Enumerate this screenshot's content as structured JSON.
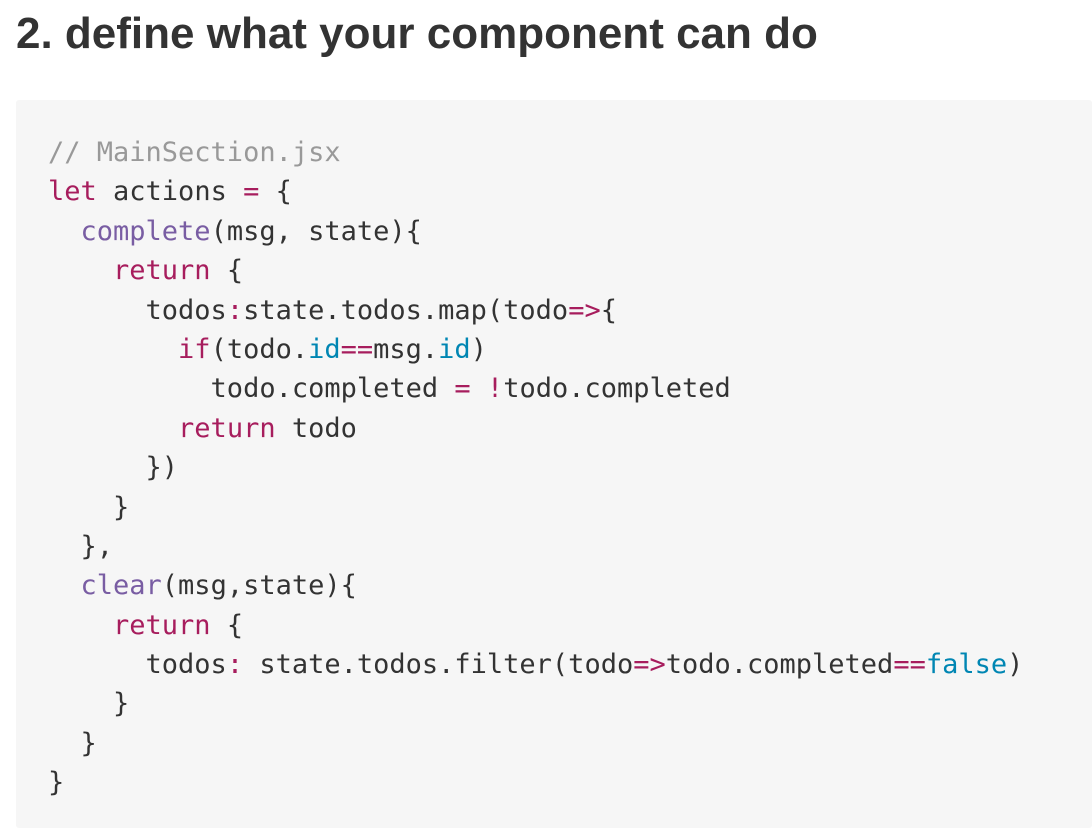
{
  "document": {
    "heading": "2. define what your component can do"
  },
  "code_block": {
    "lines": [
      [
        {
          "t": "// MainSection.jsx",
          "k": "comment"
        }
      ],
      [
        {
          "t": "let",
          "k": "keyword"
        },
        {
          "t": " actions ",
          "k": "plain"
        },
        {
          "t": "=",
          "k": "op"
        },
        {
          "t": " {",
          "k": "plain"
        }
      ],
      [
        {
          "t": "  ",
          "k": "plain"
        },
        {
          "t": "complete",
          "k": "func"
        },
        {
          "t": "(msg, state){",
          "k": "plain"
        }
      ],
      [
        {
          "t": "    ",
          "k": "plain"
        },
        {
          "t": "return",
          "k": "keyword"
        },
        {
          "t": " {",
          "k": "plain"
        }
      ],
      [
        {
          "t": "      todos",
          "k": "plain"
        },
        {
          "t": ":",
          "k": "op"
        },
        {
          "t": "state.todos.map(todo",
          "k": "plain"
        },
        {
          "t": "=>",
          "k": "op"
        },
        {
          "t": "{",
          "k": "plain"
        }
      ],
      [
        {
          "t": "        ",
          "k": "plain"
        },
        {
          "t": "if",
          "k": "keyword"
        },
        {
          "t": "(todo.",
          "k": "plain"
        },
        {
          "t": "id",
          "k": "prop"
        },
        {
          "t": "==",
          "k": "op"
        },
        {
          "t": "msg.",
          "k": "plain"
        },
        {
          "t": "id",
          "k": "prop"
        },
        {
          "t": ")",
          "k": "plain"
        }
      ],
      [
        {
          "t": "          todo.completed ",
          "k": "plain"
        },
        {
          "t": "=",
          "k": "op"
        },
        {
          "t": " ",
          "k": "plain"
        },
        {
          "t": "!",
          "k": "op"
        },
        {
          "t": "todo.completed",
          "k": "plain"
        }
      ],
      [
        {
          "t": "        ",
          "k": "plain"
        },
        {
          "t": "return",
          "k": "keyword"
        },
        {
          "t": " todo",
          "k": "plain"
        }
      ],
      [
        {
          "t": "      })",
          "k": "plain"
        }
      ],
      [
        {
          "t": "    }",
          "k": "plain"
        }
      ],
      [
        {
          "t": "  },",
          "k": "plain"
        }
      ],
      [
        {
          "t": "  ",
          "k": "plain"
        },
        {
          "t": "clear",
          "k": "func"
        },
        {
          "t": "(msg,state){",
          "k": "plain"
        }
      ],
      [
        {
          "t": "    ",
          "k": "plain"
        },
        {
          "t": "return",
          "k": "keyword"
        },
        {
          "t": " {",
          "k": "plain"
        }
      ],
      [
        {
          "t": "      todos",
          "k": "plain"
        },
        {
          "t": ":",
          "k": "op"
        },
        {
          "t": " state.todos.filter(todo",
          "k": "plain"
        },
        {
          "t": "=>",
          "k": "op"
        },
        {
          "t": "todo.completed",
          "k": "plain"
        },
        {
          "t": "==",
          "k": "op"
        },
        {
          "t": "false",
          "k": "prop"
        },
        {
          "t": ")",
          "k": "plain"
        }
      ],
      [
        {
          "t": "    }",
          "k": "plain"
        }
      ],
      [
        {
          "t": "  }",
          "k": "plain"
        }
      ],
      [
        {
          "t": "}",
          "k": "plain"
        }
      ]
    ]
  }
}
